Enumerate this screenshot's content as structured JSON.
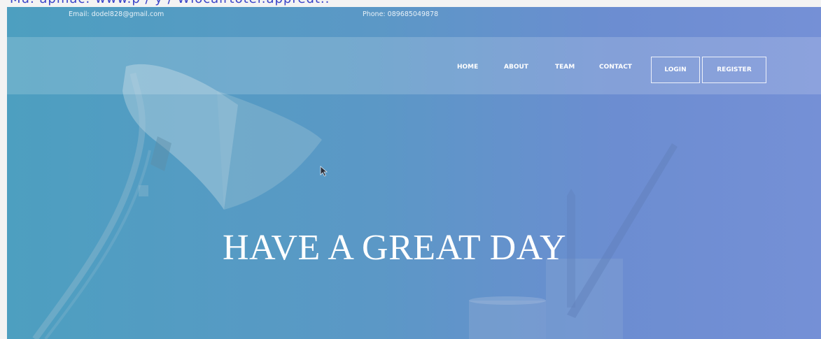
{
  "browser_fragment": {
    "text": "Mu. apmac: www.p / y / Wlocalrtotel.appredt.."
  },
  "topbar": {
    "email": "Email: dodel828@gmail.com",
    "phone": "Phone: 089685049878"
  },
  "nav": {
    "links": [
      "HOME",
      "ABOUT",
      "TEAM",
      "CONTACT"
    ],
    "login_label": "LOGIN",
    "register_label": "REGISTER"
  },
  "hero": {
    "headline": "HAVE A GREAT DAY"
  },
  "colors": {
    "hero_left": "#4d9fc0",
    "hero_right": "#7590d6",
    "text": "#ffffff"
  },
  "icons": [
    "desk-lamp-illustration",
    "pencil-cup-illustration",
    "mouse-cursor-icon"
  ]
}
